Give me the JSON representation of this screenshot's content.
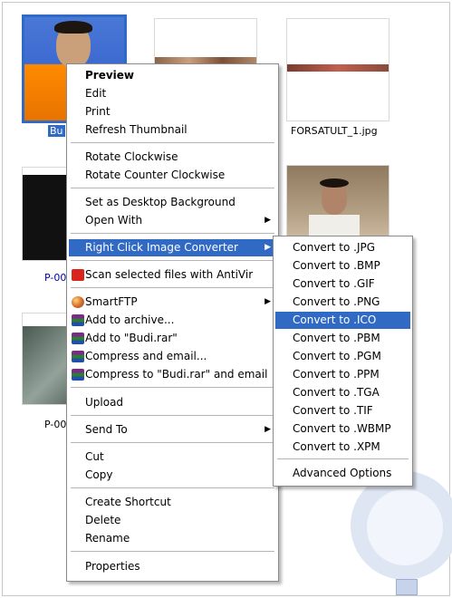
{
  "files": [
    {
      "caption": "Bu"
    },
    {
      "caption": ""
    },
    {
      "caption": "FORSATULT_1.jpg"
    },
    {
      "caption": "P-00"
    },
    {
      "caption": ""
    },
    {
      "caption": "P-00"
    }
  ],
  "context_menu": {
    "items": [
      {
        "label": "Preview"
      },
      {
        "label": "Edit"
      },
      {
        "label": "Print"
      },
      {
        "label": "Refresh Thumbnail"
      },
      {
        "label": "Rotate Clockwise"
      },
      {
        "label": "Rotate Counter Clockwise"
      },
      {
        "label": "Set as Desktop Background"
      },
      {
        "label": "Open With"
      },
      {
        "label": "Right Click Image Converter"
      },
      {
        "label": "Scan selected files with AntiVir"
      },
      {
        "label": "SmartFTP"
      },
      {
        "label": "Add to archive..."
      },
      {
        "label": "Add to \"Budi.rar\""
      },
      {
        "label": "Compress and email..."
      },
      {
        "label": "Compress to \"Budi.rar\" and email"
      },
      {
        "label": "Upload"
      },
      {
        "label": "Send To"
      },
      {
        "label": "Cut"
      },
      {
        "label": "Copy"
      },
      {
        "label": "Create Shortcut"
      },
      {
        "label": "Delete"
      },
      {
        "label": "Rename"
      },
      {
        "label": "Properties"
      }
    ]
  },
  "submenu": {
    "items": [
      {
        "label": "Convert to .JPG"
      },
      {
        "label": "Convert to .BMP"
      },
      {
        "label": "Convert to .GIF"
      },
      {
        "label": "Convert to .PNG"
      },
      {
        "label": "Convert to .ICO"
      },
      {
        "label": "Convert to .PBM"
      },
      {
        "label": "Convert to .PGM"
      },
      {
        "label": "Convert to .PPM"
      },
      {
        "label": "Convert to .TGA"
      },
      {
        "label": "Convert to .TIF"
      },
      {
        "label": "Convert to .WBMP"
      },
      {
        "label": "Convert to .XPM"
      },
      {
        "label": "Advanced Options"
      }
    ]
  },
  "colors": {
    "selection": "#316ac5",
    "menu_border": "#8a8a8a"
  },
  "icons": {
    "antivir": "antivir-icon",
    "smartftp": "smartftp-icon",
    "rar": "winrar-icon"
  }
}
